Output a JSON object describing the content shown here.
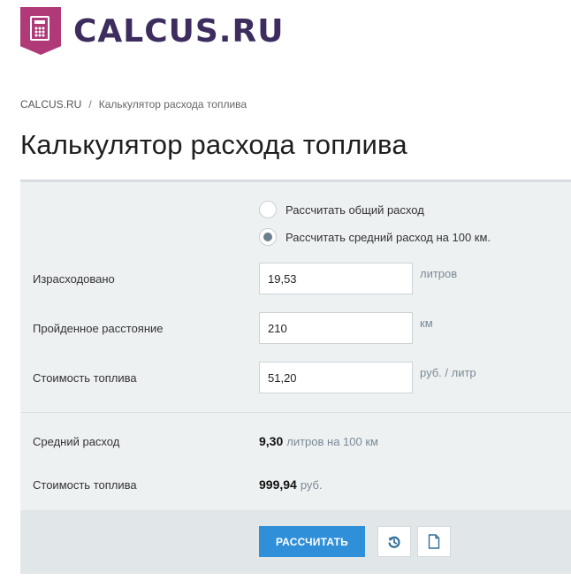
{
  "header": {
    "logo_text": "CALCUS.RU"
  },
  "breadcrumb": {
    "home": "CALCUS.RU",
    "separator": "/",
    "current": "Калькулятор расхода топлива"
  },
  "page": {
    "title": "Калькулятор расхода топлива"
  },
  "mode": {
    "options": [
      {
        "label": "Рассчитать общий расход",
        "checked": false
      },
      {
        "label": "Рассчитать средний расход на 100 км.",
        "checked": true
      }
    ]
  },
  "fields": {
    "consumed": {
      "label": "Израсходовано",
      "value": "19,53",
      "unit": "литров"
    },
    "distance": {
      "label": "Пройденное расстояние",
      "value": "210",
      "unit": "км"
    },
    "price": {
      "label": "Стоимость топлива",
      "value": "51,20",
      "unit": "руб. / литр"
    }
  },
  "results": {
    "avg": {
      "label": "Средний расход",
      "value": "9,30",
      "unit": "литров на 100 км"
    },
    "cost": {
      "label": "Стоимость топлива",
      "value": "999,94",
      "unit": "руб."
    }
  },
  "actions": {
    "calculate_label": "РАССЧИТАТЬ",
    "reset_icon": "reset-icon",
    "doc_icon": "document-icon"
  },
  "colors": {
    "brand": "#b03a78",
    "logo_text": "#3d2c5e",
    "button": "#2f8fd8"
  }
}
